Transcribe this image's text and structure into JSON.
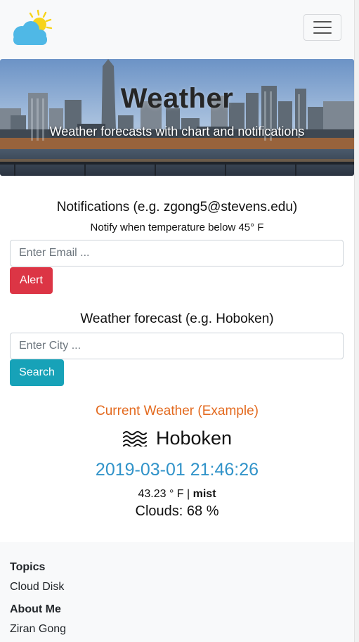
{
  "navbar": {
    "logo_icon": "sun-behind-cloud-icon",
    "toggler_icon": "hamburger-menu-icon"
  },
  "hero": {
    "title": "Weather",
    "subtitle": "Weather forecasts with chart and notifications"
  },
  "notifications": {
    "heading": "Notifications (e.g. zgong5@stevens.edu)",
    "subheading": "Notify when temperature below 45° F",
    "email_placeholder": "Enter Email ...",
    "alert_label": "Alert"
  },
  "forecast": {
    "heading": "Weather forecast (e.g. Hoboken)",
    "city_placeholder": "Enter City ...",
    "search_label": "Search"
  },
  "current": {
    "title": "Current Weather (Example)",
    "weather_icon": "mist-icon",
    "city": "Hoboken",
    "timestamp": "2019-03-01 21:46:26",
    "temp_text": "43.23 ° F | ",
    "condition": "mist",
    "clouds": "Clouds: 68 %"
  },
  "footer": {
    "topics_heading": "Topics",
    "topics_link": "Cloud Disk",
    "about_heading": "About Me",
    "about_link": "Ziran Gong"
  },
  "colors": {
    "alert_button": "#dc3545",
    "search_button": "#17a2b8",
    "current_title": "#e36a1f",
    "timestamp": "#3193c9"
  }
}
